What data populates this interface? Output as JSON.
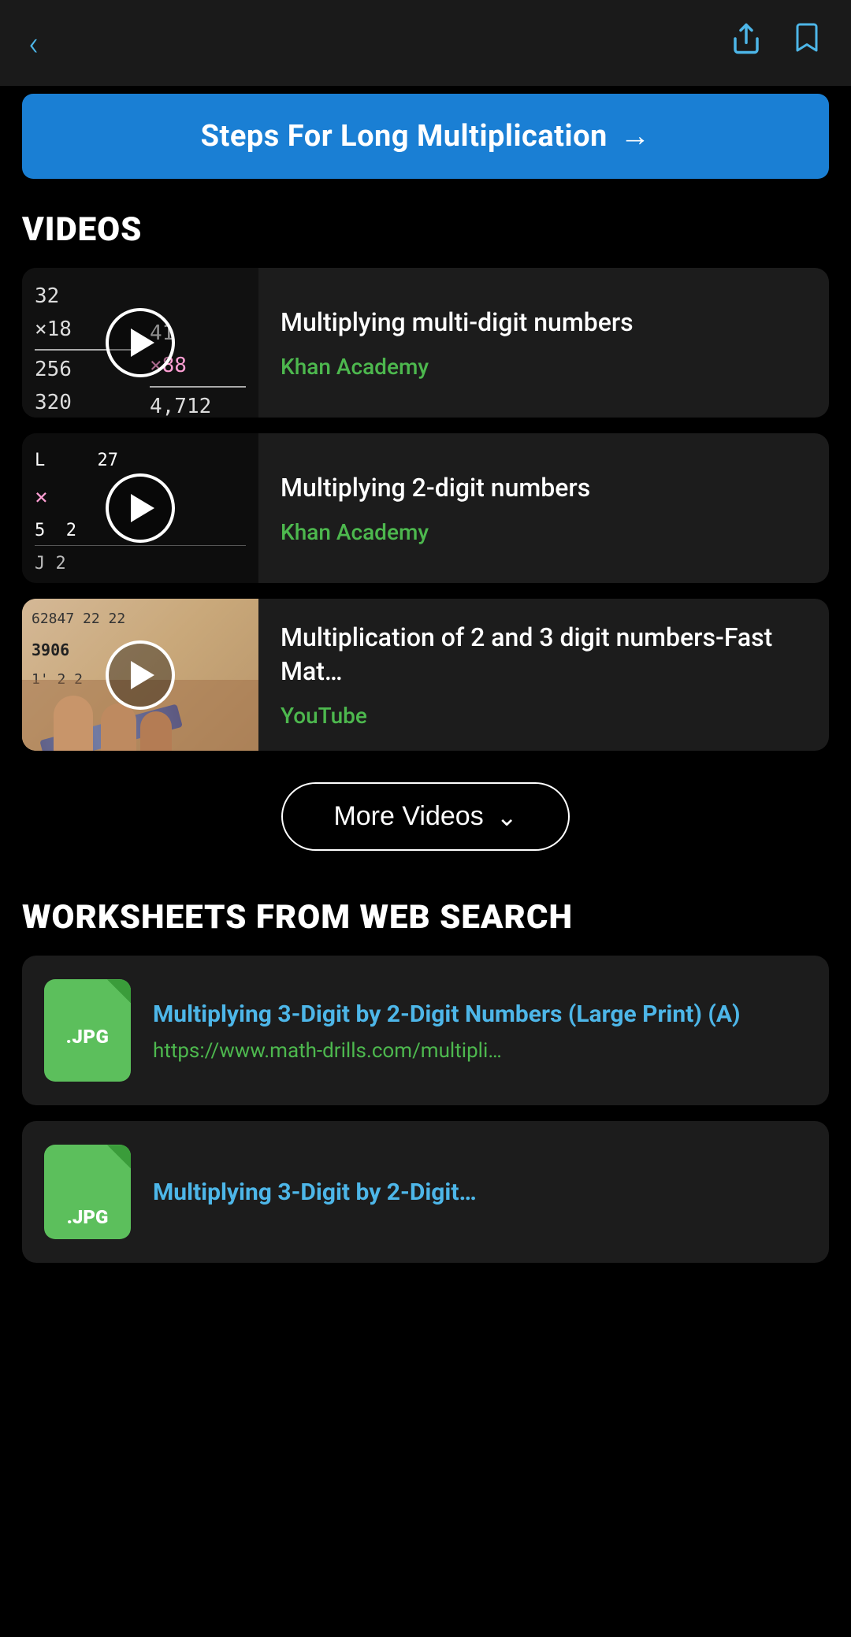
{
  "topBar": {
    "backLabel": "‹",
    "shareLabel": "↗",
    "bookmarkLabel": "🔖"
  },
  "banner": {
    "text": "Steps For Long Multiplication",
    "arrow": "→"
  },
  "videosSection": {
    "heading": "VIDEOS",
    "videos": [
      {
        "title": "Multiplying multi-digit numbers",
        "source": "Khan Academy",
        "thumbType": "khan1"
      },
      {
        "title": "Multiplying 2-digit numbers",
        "source": "Khan Academy",
        "thumbType": "khan2"
      },
      {
        "title": "Multiplication of 2 and 3 digit numbers-Fast Mat…",
        "source": "YouTube",
        "thumbType": "youtube"
      }
    ],
    "moreButton": "More Videos",
    "moreChevron": "⌄"
  },
  "worksheetsSection": {
    "heading": "WORKSHEETS FROM WEB SEARCH",
    "worksheets": [
      {
        "ext": ".JPG",
        "title": "Multiplying 3-Digit by 2-Digit Numbers (Large Print) (A)",
        "url": "https://www.math-drills.com/multipli…"
      },
      {
        "ext": ".JPG",
        "title": "Multiplying 3-Digit by 2-Digit…",
        "url": ""
      }
    ]
  }
}
